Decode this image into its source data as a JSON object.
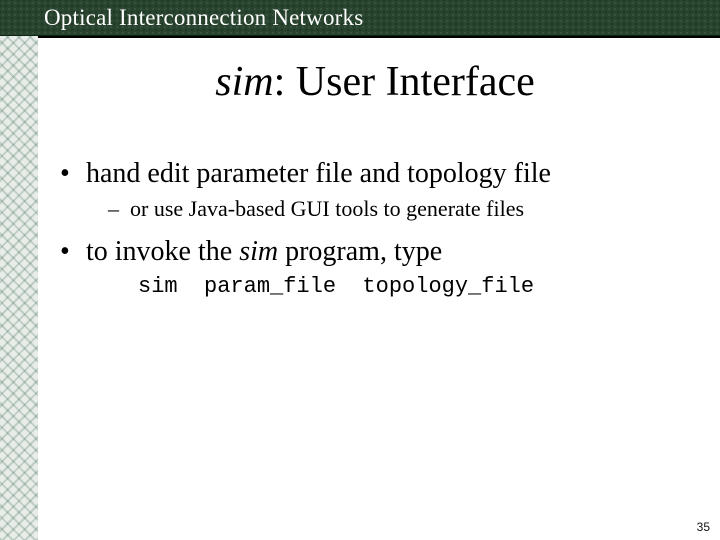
{
  "header": {
    "title": "Optical Interconnection Networks"
  },
  "title": {
    "italic": "sim",
    "rest": ": User Interface"
  },
  "bullets": {
    "b1": "hand edit parameter file and topology file",
    "b1_sub": "or use Java-based GUI tools to generate files",
    "b2_pre": "to invoke the ",
    "b2_italic": "sim",
    "b2_post": " program, type",
    "cmd": "sim  param_file  topology_file"
  },
  "page": "35"
}
